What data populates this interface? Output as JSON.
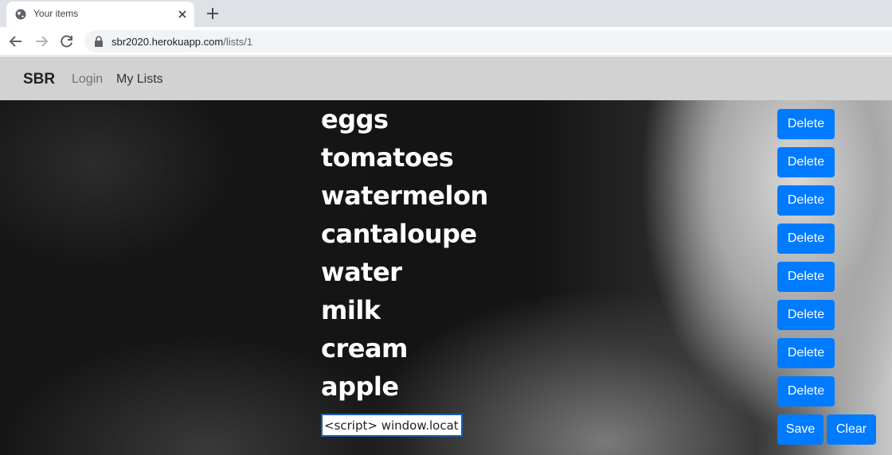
{
  "browser": {
    "tab_title": "Your items",
    "url_host": "sbr2020.herokuapp.com",
    "url_path": "/lists/1"
  },
  "navbar": {
    "brand": "SBR",
    "login": "Login",
    "my_lists": "My Lists"
  },
  "items": [
    {
      "name": "eggs",
      "action": "Delete"
    },
    {
      "name": "tomatoes",
      "action": "Delete"
    },
    {
      "name": "watermelon",
      "action": "Delete"
    },
    {
      "name": "cantaloupe",
      "action": "Delete"
    },
    {
      "name": "water",
      "action": "Delete"
    },
    {
      "name": "milk",
      "action": "Delete"
    },
    {
      "name": "cream",
      "action": "Delete"
    },
    {
      "name": "apple",
      "action": "Delete"
    }
  ],
  "form": {
    "input_value": "<script> window.locatio",
    "save_label": "Save",
    "clear_label": "Clear"
  },
  "colors": {
    "primary": "#007bff",
    "navbar_bg": "#d2d2d2"
  }
}
